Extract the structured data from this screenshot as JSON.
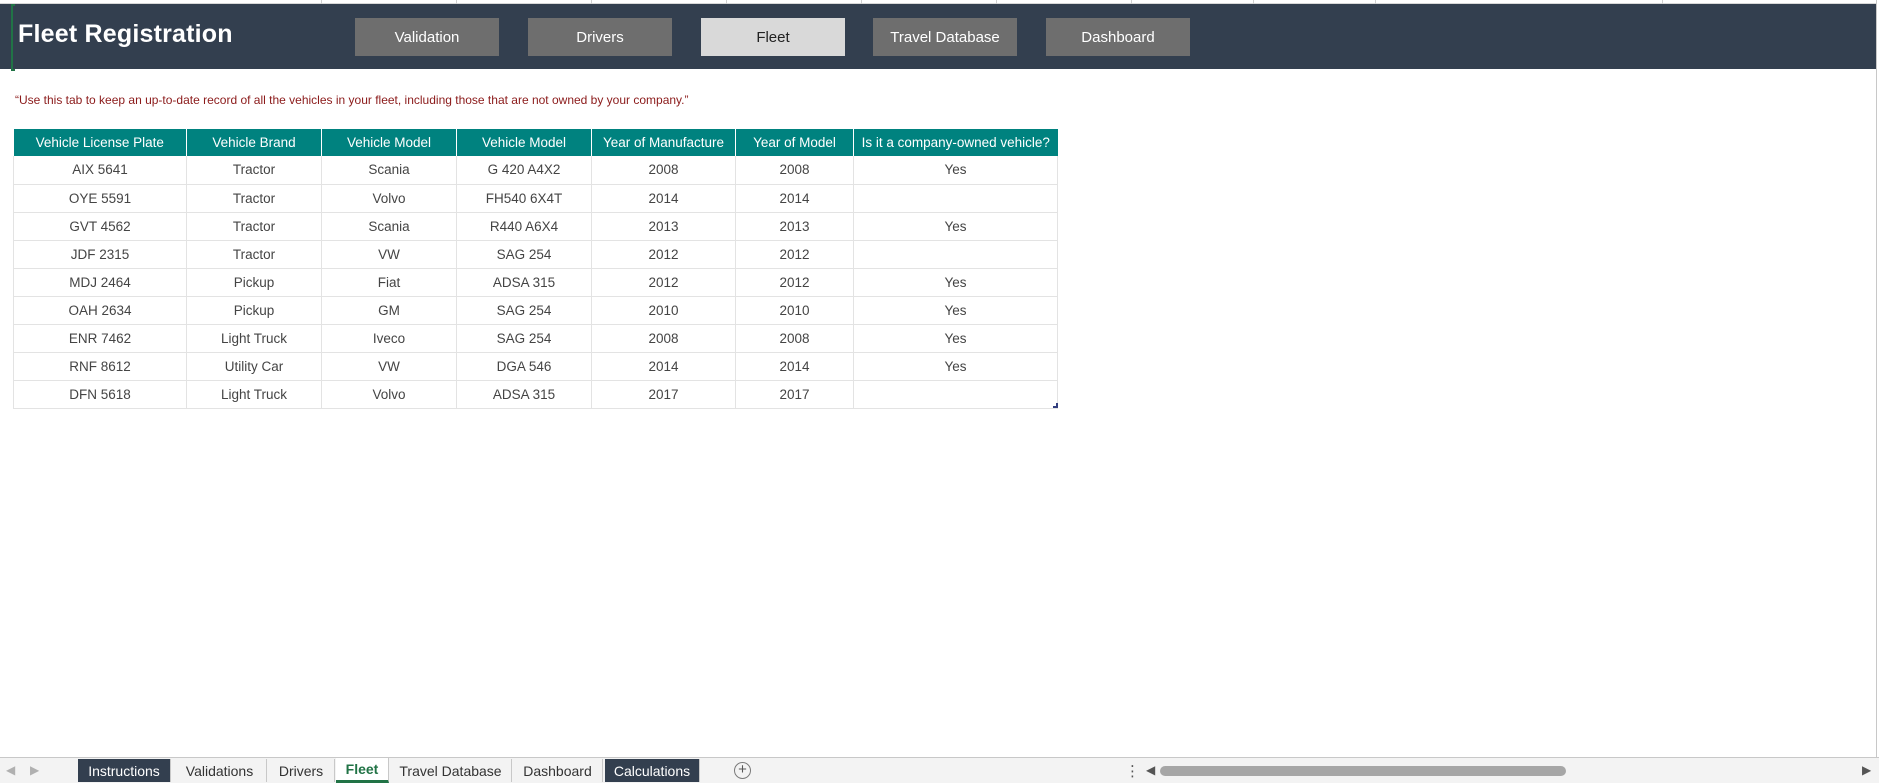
{
  "header": {
    "title": "Fleet Registration",
    "nav_buttons": [
      {
        "label": "Validation"
      },
      {
        "label": "Drivers"
      },
      {
        "label": "Fleet"
      },
      {
        "label": "Travel Database"
      },
      {
        "label": "Dashboard"
      }
    ],
    "active_nav": "Fleet"
  },
  "note": "“Use this tab to keep an up-to-date record of all the vehicles in your fleet, including those that are not owned by your company.”",
  "table": {
    "columns": [
      "Vehicle License Plate",
      "Vehicle Brand",
      "Vehicle Model",
      "Vehicle Model",
      "Year of Manufacture",
      "Year of Model",
      "Is it a company-owned vehicle?"
    ],
    "rows": [
      [
        "AIX 5641",
        "Tractor",
        "Scania",
        "G 420 A4X2",
        "2008",
        "2008",
        "Yes"
      ],
      [
        "OYE 5591",
        "Tractor",
        "Volvo",
        "FH540 6X4T",
        "2014",
        "2014",
        ""
      ],
      [
        "GVT 4562",
        "Tractor",
        "Scania",
        "R440 A6X4",
        "2013",
        "2013",
        "Yes"
      ],
      [
        "JDF 2315",
        "Tractor",
        "VW",
        "SAG 254",
        "2012",
        "2012",
        ""
      ],
      [
        "MDJ 2464",
        "Pickup",
        "Fiat",
        "ADSA 315",
        "2012",
        "2012",
        "Yes"
      ],
      [
        "OAH 2634",
        "Pickup",
        "GM",
        "SAG 254",
        "2010",
        "2010",
        "Yes"
      ],
      [
        "ENR 7462",
        "Light Truck",
        "Iveco",
        "SAG 254",
        "2008",
        "2008",
        "Yes"
      ],
      [
        "RNF 8612",
        "Utility Car",
        "VW",
        "DGA 546",
        "2014",
        "2014",
        "Yes"
      ],
      [
        "DFN 5618",
        "Light Truck",
        "Volvo",
        "ADSA 315",
        "2017",
        "2017",
        ""
      ]
    ]
  },
  "sheet_tabs": [
    {
      "label": "Instructions",
      "style": "dark"
    },
    {
      "label": "Validations",
      "style": "normal"
    },
    {
      "label": "Drivers",
      "style": "normal"
    },
    {
      "label": "Fleet",
      "style": "active"
    },
    {
      "label": "Travel Database",
      "style": "normal"
    },
    {
      "label": "Dashboard",
      "style": "normal"
    },
    {
      "label": "Calculations",
      "style": "dark"
    }
  ],
  "icons": {
    "add_sheet": "plus-circle-icon",
    "more_options": "vertical-dots-icon",
    "scroll_left": "triangle-left-icon",
    "scroll_right": "triangle-right-icon"
  },
  "colors": {
    "header_bg": "#333f4f",
    "table_header_bg": "#00827f",
    "nav_button_bg": "#6e6e6e",
    "nav_button_active_bg": "#d9d9d9",
    "note_text": "#8b1a1a",
    "active_tab_text": "#217346"
  },
  "scrollbar": {
    "position_fraction": 0.0,
    "visible_fraction": 0.58
  }
}
